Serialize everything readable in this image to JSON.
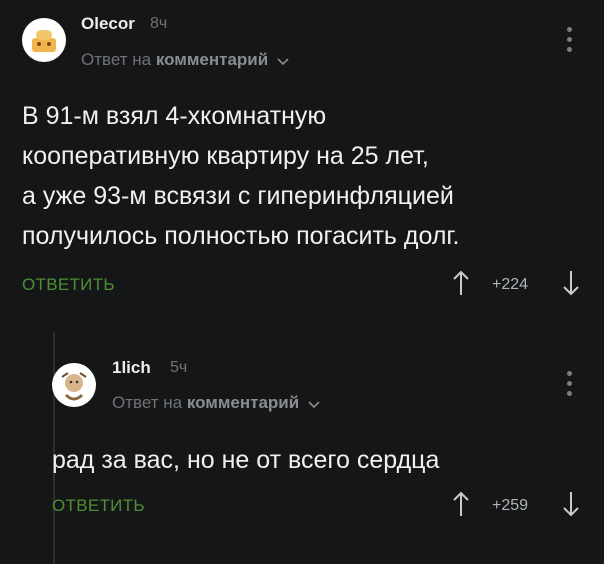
{
  "comments": [
    {
      "author": "Olecor",
      "time": "8ч",
      "reply_prefix": "Ответ на",
      "reply_target": "комментарий",
      "text_lines": [
        "В 91-м взял 4-хкомнатную",
        "кооперативную квартиру на 25 лет,",
        "а уже 93-м всвязи с гиперинфляцией",
        "получилось полностью погасить долг."
      ],
      "reply_label": "ОТВЕТИТЬ",
      "rating": "+224"
    },
    {
      "author": "1lich",
      "time": "5ч",
      "reply_prefix": "Ответ на",
      "reply_target": "комментарий",
      "text_lines": [
        "рад за вас, но не от всего сердца"
      ],
      "reply_label": "ОТВЕТИТЬ",
      "rating": "+259"
    }
  ],
  "colors": {
    "background": "#151617",
    "accent": "#4e8f36",
    "muted": "#6f7275"
  },
  "icons": [
    "avatar",
    "chevron-down-icon",
    "more-vertical-icon",
    "arrow-up-icon",
    "arrow-down-icon"
  ]
}
